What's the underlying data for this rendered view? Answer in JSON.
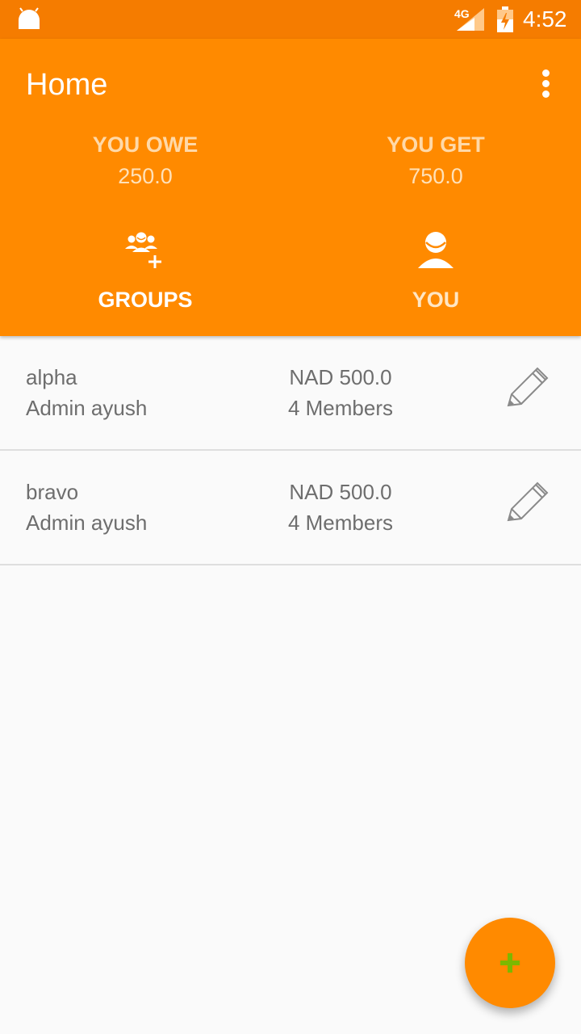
{
  "status_bar": {
    "network": "4G",
    "time": "4:52"
  },
  "header": {
    "title": "Home",
    "owe_label": "YOU OWE",
    "owe_value": "250.0",
    "get_label": "YOU GET",
    "get_value": "750.0"
  },
  "tabs": [
    {
      "label": "GROUPS",
      "icon": "group-add-icon"
    },
    {
      "label": "YOU",
      "icon": "person-icon"
    }
  ],
  "groups": [
    {
      "name": "alpha",
      "admin": "Admin ayush",
      "amount": "NAD 500.0",
      "members": "4 Members"
    },
    {
      "name": "bravo",
      "admin": "Admin ayush",
      "amount": "NAD 500.0",
      "members": "4 Members"
    }
  ],
  "colors": {
    "status_bar": "#f57c00",
    "primary": "#ff8a00",
    "fab_plus": "#7cb800"
  }
}
